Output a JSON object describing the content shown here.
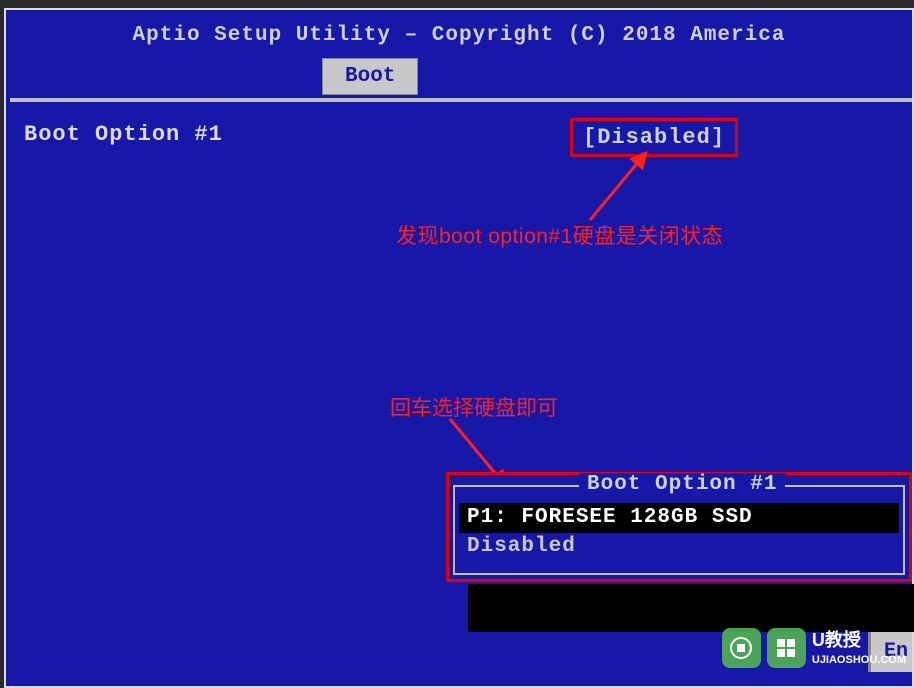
{
  "header": {
    "title": "Aptio Setup Utility – Copyright (C) 2018 America"
  },
  "tab": {
    "active": "Boot"
  },
  "main": {
    "boot_option_label": "Boot Option #1",
    "boot_option_value": "[Disabled]"
  },
  "popup": {
    "title": "Boot Option #1",
    "option_selected": "P1: FORESEE 128GB SSD",
    "option_other": "Disabled"
  },
  "annotations": {
    "note1": "发现boot option#1硬盘是关闭状态",
    "note2": "回车选择硬盘即可"
  },
  "rightpanel": {
    "hint": "En"
  },
  "watermark": {
    "brand": "U教授",
    "url": "UJIAOSHOU.COM"
  }
}
